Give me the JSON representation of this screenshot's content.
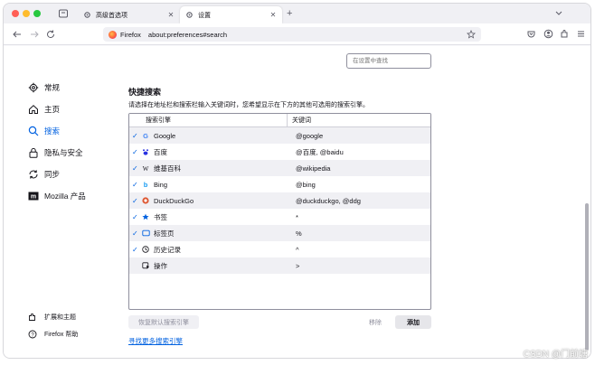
{
  "tabs": [
    {
      "label": "高级首选项"
    },
    {
      "label": "设置"
    }
  ],
  "nav": {
    "identity": "Firefox",
    "url": "about:preferences#search"
  },
  "search_prefs": {
    "placeholder": "在设置中查找"
  },
  "sidebar": {
    "items": [
      {
        "label": "常规",
        "icon": "gear-icon"
      },
      {
        "label": "主页",
        "icon": "home-icon"
      },
      {
        "label": "搜索",
        "icon": "search-icon",
        "selected": true
      },
      {
        "label": "隐私与安全",
        "icon": "lock-icon"
      },
      {
        "label": "同步",
        "icon": "sync-icon"
      },
      {
        "label": "Mozilla 产品",
        "icon": "mozilla-logo-icon"
      }
    ],
    "footer": [
      {
        "label": "扩展和主题",
        "icon": "puzzle-icon"
      },
      {
        "label": "Firefox 帮助",
        "icon": "help-icon"
      }
    ]
  },
  "shortcuts": {
    "title": "快捷搜索",
    "description": "请选择在地址栏和搜索栏输入关键词时，您希望显示在下方的其他可选用的搜索引擎。",
    "headers": [
      "搜索引擎",
      "关键词"
    ],
    "rows": [
      {
        "name": "Google",
        "keyword": "@google",
        "checked": true,
        "icon": "google-icon"
      },
      {
        "name": "百度",
        "keyword": "@百度, @baidu",
        "checked": true,
        "icon": "baidu-icon"
      },
      {
        "name": "维基百科",
        "keyword": "@wikipedia",
        "checked": true,
        "icon": "wikipedia-icon"
      },
      {
        "name": "Bing",
        "keyword": "@bing",
        "checked": true,
        "icon": "bing-icon"
      },
      {
        "name": "DuckDuckGo",
        "keyword": "@duckduckgo, @ddg",
        "checked": true,
        "icon": "duckduckgo-icon"
      },
      {
        "name": "书签",
        "keyword": "*",
        "checked": true,
        "icon": "bookmark-star-icon"
      },
      {
        "name": "标签页",
        "keyword": "%",
        "checked": true,
        "icon": "tab-icon"
      },
      {
        "name": "历史记录",
        "keyword": "^",
        "checked": true,
        "icon": "history-icon"
      },
      {
        "name": "操作",
        "keyword": ">",
        "checked": false,
        "icon": "actions-icon"
      }
    ],
    "restore_label": "恢复默认搜索引擎",
    "remove_label": "移除",
    "add_label": "添加",
    "find_more_label": "寻找更多搜索引擎"
  },
  "watermark": "CSDN @门前塘",
  "colors": {
    "accent": "#0061e0",
    "checkmark": "#0061e0"
  }
}
